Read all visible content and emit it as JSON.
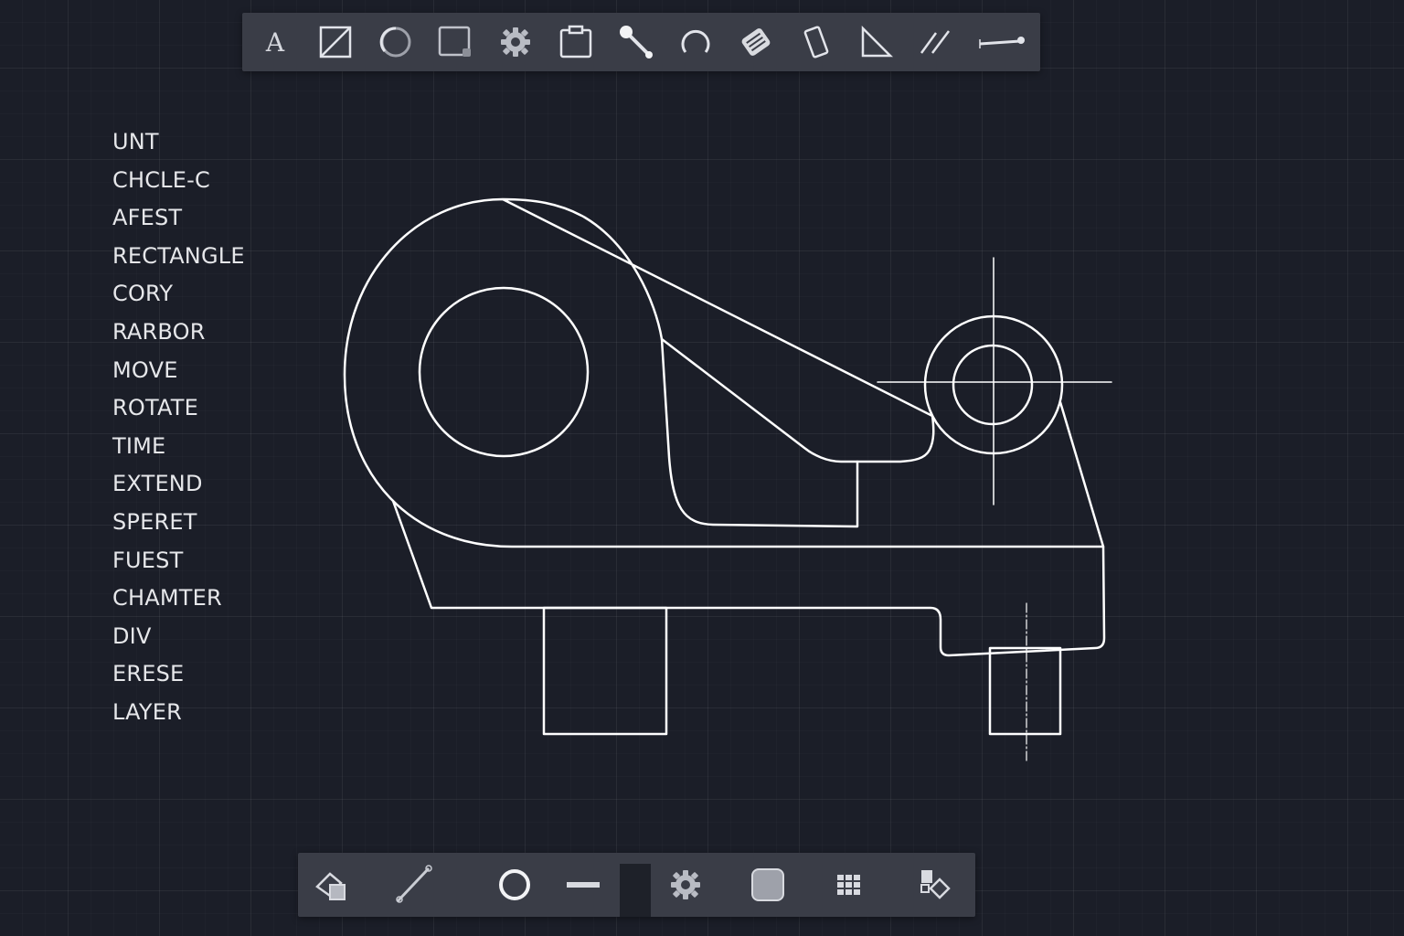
{
  "top_toolbar": {
    "tools": [
      {
        "icon": "text-icon",
        "glyph": "A"
      },
      {
        "icon": "line-box-icon"
      },
      {
        "icon": "circle-icon"
      },
      {
        "icon": "rectangle-corner-icon"
      },
      {
        "icon": "gear-icon"
      },
      {
        "icon": "clipboard-icon"
      },
      {
        "icon": "pin-line-icon"
      },
      {
        "icon": "arc-icon"
      },
      {
        "icon": "hatch-box-icon"
      },
      {
        "icon": "rotated-rectangle-icon"
      },
      {
        "icon": "triangle-icon"
      },
      {
        "icon": "parallel-lines-icon"
      },
      {
        "icon": "dimension-line-icon"
      }
    ]
  },
  "command_list": {
    "items": [
      "UNT",
      "CHCLE-C",
      "AFEST",
      "RECTANGLE",
      "CORY",
      "RARBOR",
      "MOVE",
      "ROTATE",
      "TIME",
      "EXTEND",
      "SPERET",
      "FUEST",
      "CHAMTER",
      "DIV",
      "ERESE",
      "LAYER"
    ]
  },
  "bottom_toolbar": {
    "tools": [
      {
        "icon": "layers-stack-icon"
      },
      {
        "icon": "pencil-line-icon"
      },
      {
        "icon": "circle-outline-icon"
      },
      {
        "icon": "horizontal-line-icon"
      },
      {
        "icon": "settings-gear-icon"
      },
      {
        "icon": "rounded-square-icon"
      },
      {
        "icon": "grid-icon"
      },
      {
        "icon": "paint-bucket-icon"
      }
    ]
  },
  "colors": {
    "background": "#1b1e28",
    "toolbar": "#3a3d47",
    "drawing_stroke": "#ffffff",
    "text": "#e6e7ea"
  }
}
